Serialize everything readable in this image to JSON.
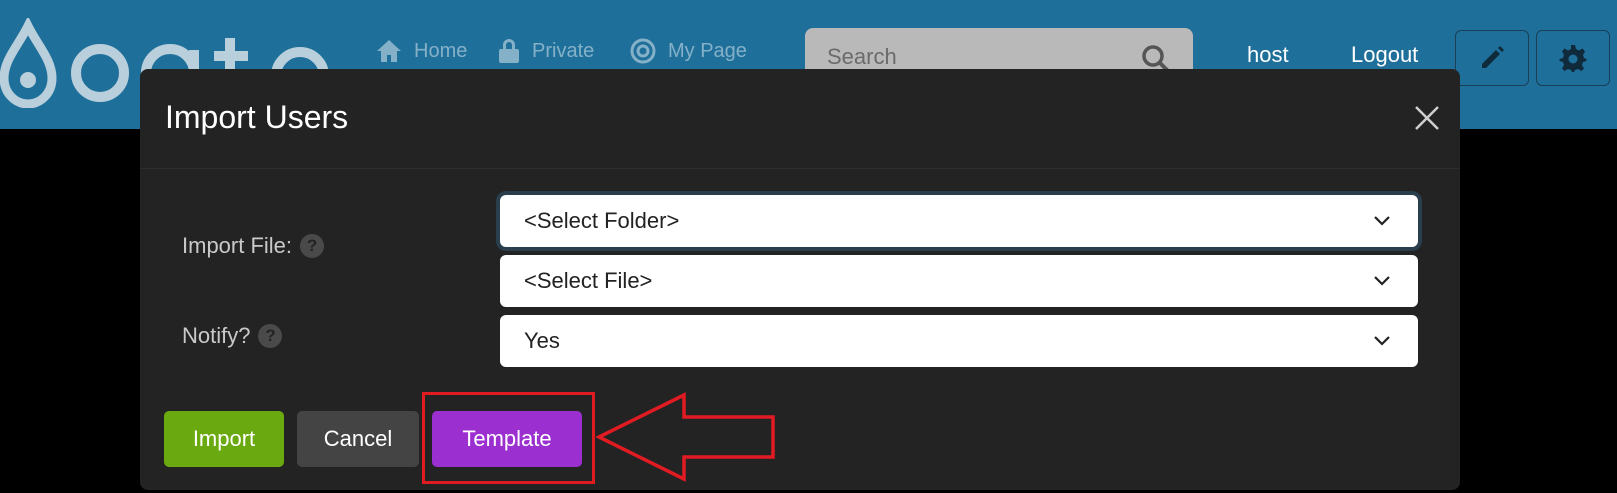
{
  "navbar": {
    "brand_icon": "droplet-logo-icon",
    "links": [
      {
        "label": "Home",
        "icon": "home-icon"
      },
      {
        "label": "Private",
        "icon": "lock-icon"
      },
      {
        "label": "My Page",
        "icon": "target-icon"
      }
    ],
    "search": {
      "placeholder": "Search",
      "icon": "search-icon"
    },
    "user": "host",
    "logout": "Logout",
    "edit_icon": "pencil-icon",
    "settings_icon": "gear-icon"
  },
  "modal": {
    "title": "Import Users",
    "close_icon": "close-icon",
    "import_file_label": "Import File:",
    "notify_label": "Notify?",
    "folder_select": {
      "value": "<Select Folder>"
    },
    "file_select": {
      "value": "<Select File>"
    },
    "notify_select": {
      "value": "Yes"
    },
    "buttons": {
      "import": "Import",
      "cancel": "Cancel",
      "template": "Template"
    }
  },
  "colors": {
    "navbar": "#1f6f9b",
    "modal_bg": "#232323",
    "import_button": "#6aaa10",
    "cancel_button": "#444444",
    "template_button": "#9b2fd0",
    "annotation_red": "#e11b22"
  }
}
